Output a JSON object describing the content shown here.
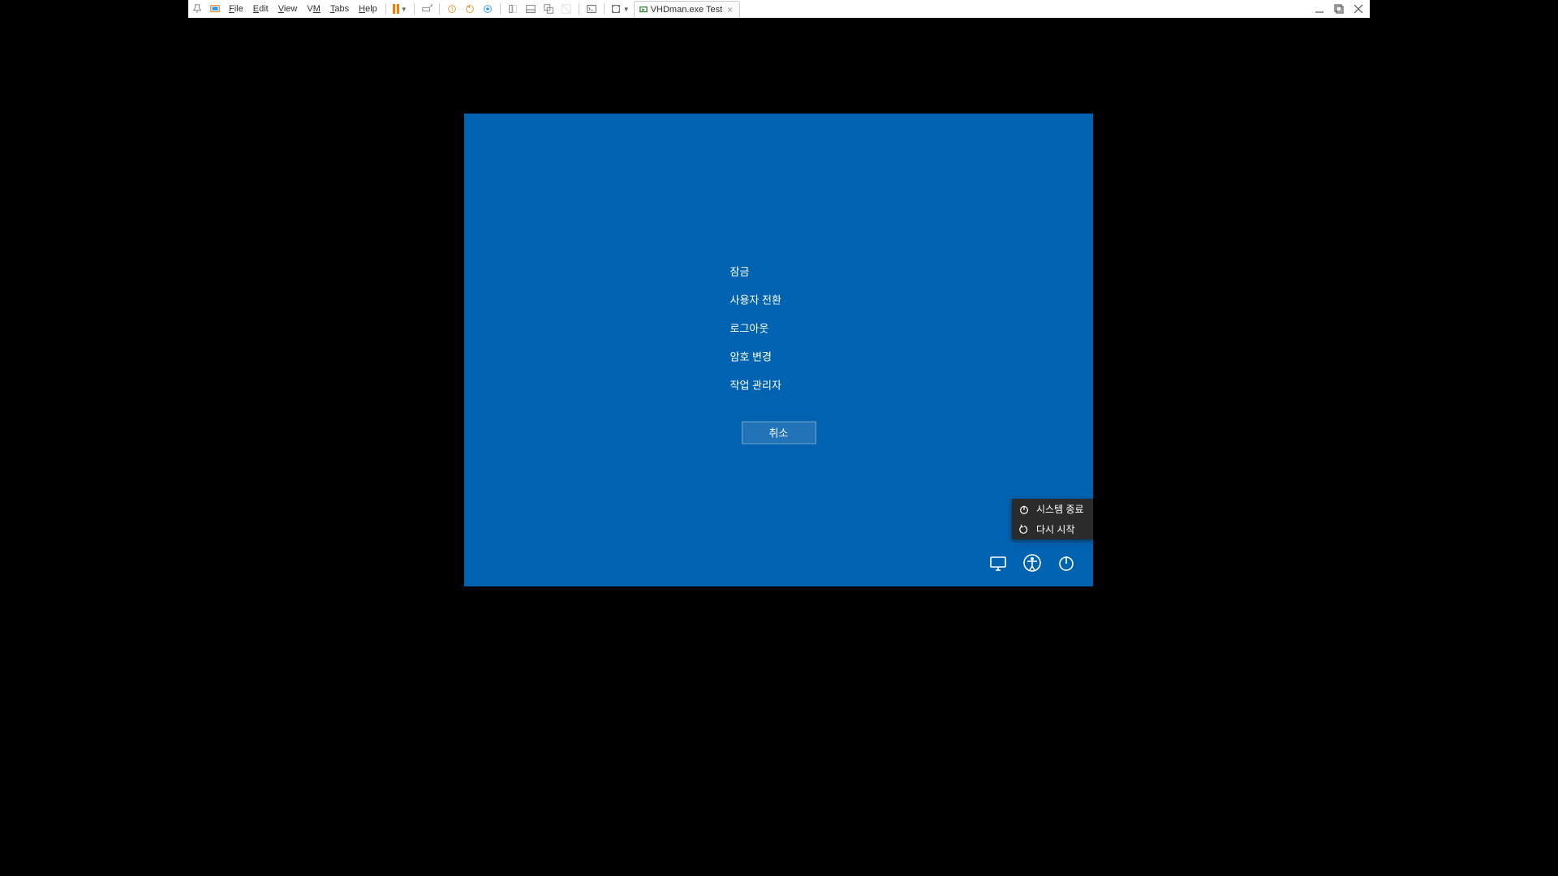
{
  "toolbar": {
    "menus": [
      "File",
      "Edit",
      "View",
      "VM",
      "Tabs",
      "Help"
    ],
    "tab_title": "VHDman.exe Test"
  },
  "security_screen": {
    "options": [
      "잠금",
      "사용자 전환",
      "로그아웃",
      "암호 변경",
      "작업 관리자"
    ],
    "cancel_label": "취소"
  },
  "power_menu": {
    "shutdown_label": "시스템 종료",
    "restart_label": "다시 시작"
  }
}
